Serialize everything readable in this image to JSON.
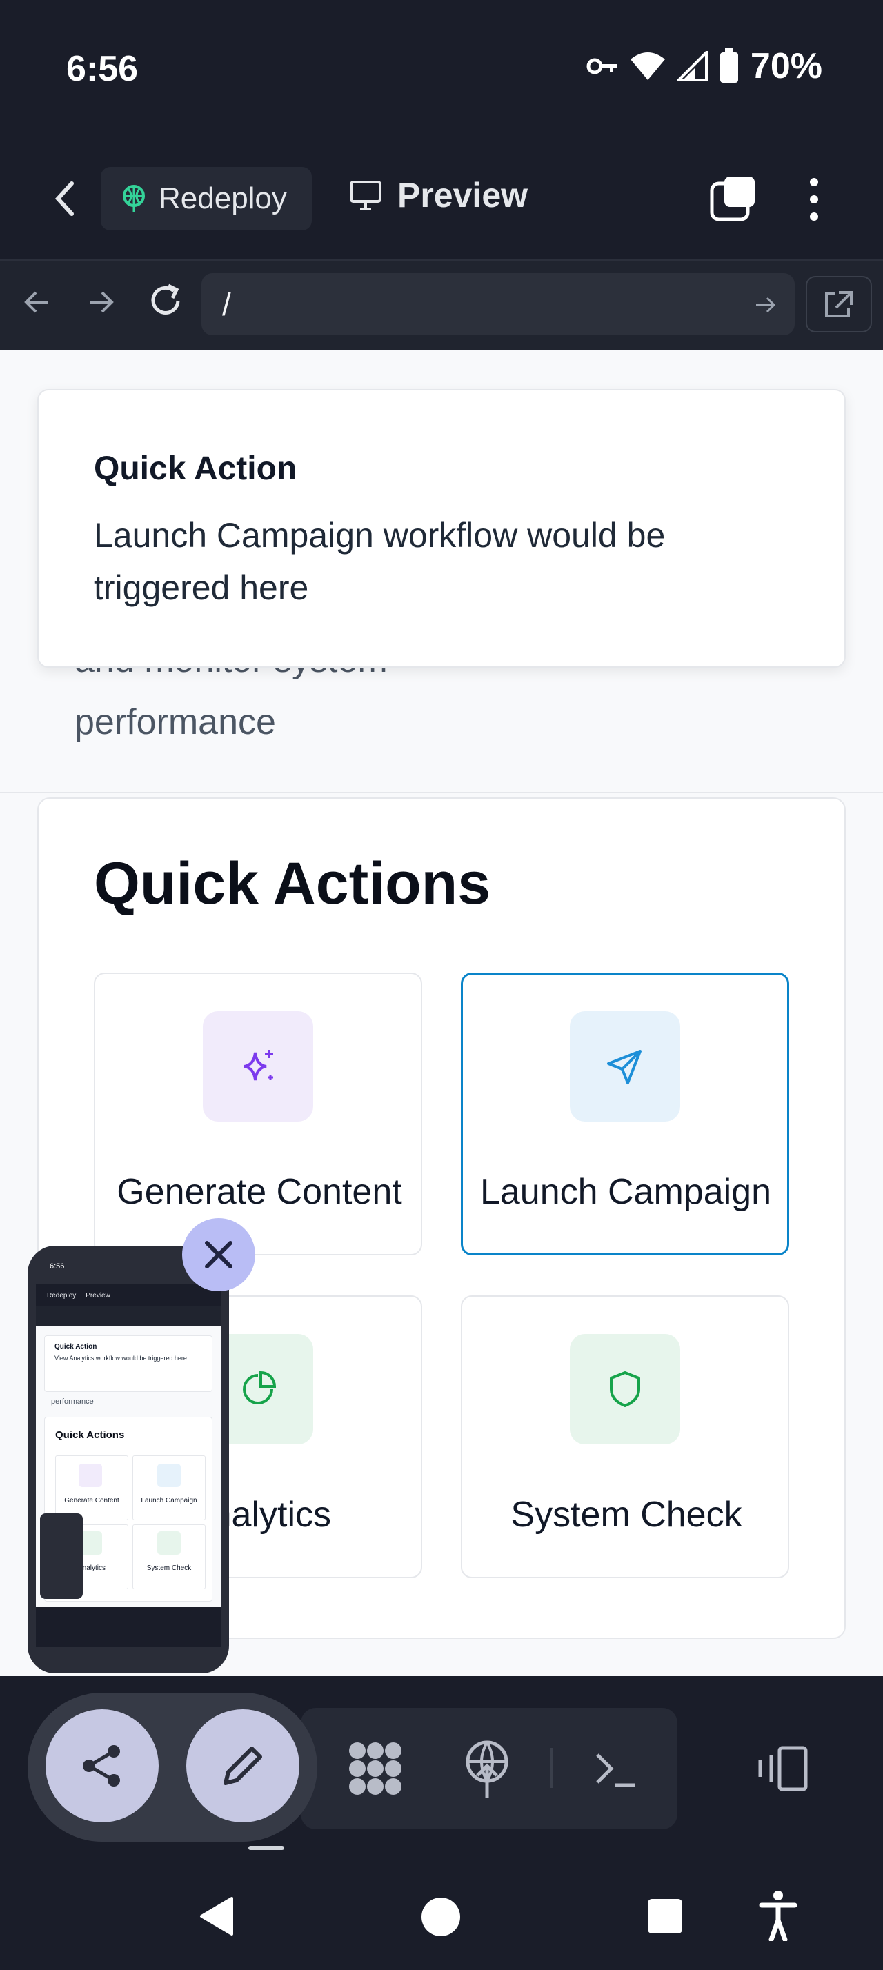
{
  "status_bar": {
    "time": "6:56",
    "battery": "70%"
  },
  "header": {
    "redeploy_label": "Redeploy",
    "preview_label": "Preview"
  },
  "url_bar": {
    "path": "/"
  },
  "background": {
    "text_partial": "and monitor system",
    "text_line2": "performance"
  },
  "toast": {
    "title": "Quick Action",
    "message": "Launch Campaign workflow would be triggered here"
  },
  "quick_actions": {
    "heading": "Quick Actions",
    "tiles": [
      {
        "label": "Generate Content",
        "icon": "sparkle-icon",
        "color": "#7c3aed",
        "bg": "#f1ebfb"
      },
      {
        "label": "Launch Campaign",
        "icon": "send-icon",
        "color": "#1d8fd8",
        "bg": "#e6f2fb"
      },
      {
        "label": "Analytics",
        "icon": "pie-chart-icon",
        "color": "#16a34a",
        "bg": "#e7f5ec"
      },
      {
        "label": "System Check",
        "icon": "shield-icon",
        "color": "#16a34a",
        "bg": "#e7f5ec"
      }
    ]
  },
  "thumbnail": {
    "time": "6:56",
    "redeploy_label": "Redeploy",
    "preview_label": "Preview",
    "toast_title": "Quick Action",
    "toast_message": "View Analytics workflow would be triggered here",
    "bg_text": "performance",
    "heading": "Quick Actions",
    "tile_labels": [
      "Generate Content",
      "Launch Campaign",
      "Analytics",
      "System Check"
    ]
  },
  "colors": {
    "dark_bg": "#1a1d29",
    "accent_border": "#0a84c9",
    "fab": "#c6c8e3"
  }
}
